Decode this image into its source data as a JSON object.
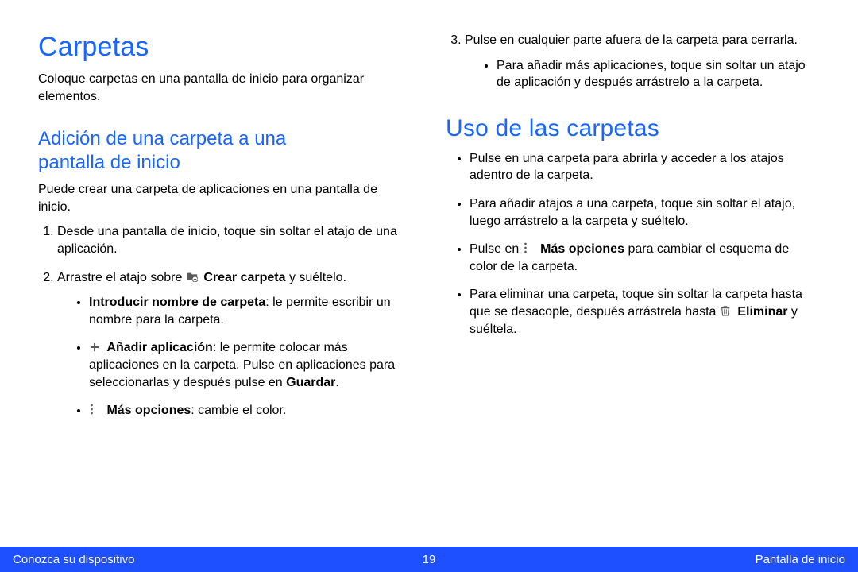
{
  "left": {
    "h1": "Carpetas",
    "intro": "Coloque carpetas en una pantalla de inicio para organizar elementos.",
    "sec1": {
      "h2_line1": "Adición de una carpeta a una",
      "h2_line2": "pantalla de inicio",
      "lead": "Puede crear una carpeta de aplicaciones en una pantalla de inicio.",
      "step1": "Desde una pantalla de inicio, toque sin soltar el atajo de una aplicación.",
      "step2_a": "Arrastre el atajo sobre ",
      "step2_bold": "Crear carpeta",
      "step2_b": " y suéltelo.",
      "sub1_bold": "Introducir nombre de carpeta",
      "sub1_rest": ": le permite escribir un nombre para la carpeta.",
      "sub2_bold": "Añadir aplicación",
      "sub2_rest_a": ": le permite colocar más aplicaciones en la carpeta. Pulse en aplicaciones para seleccionarlas y después pulse en ",
      "sub2_bold2": "Guardar",
      "sub2_rest_b": ".",
      "sub3_bold": "Más opciones",
      "sub3_rest": ": cambie el color."
    }
  },
  "right": {
    "step3": "Pulse en cualquier parte afuera de la carpeta para cerrarla.",
    "step3_sub": "Para añadir más aplicaciones, toque sin soltar un atajo de aplicación y después arrástrelo a la carpeta.",
    "h2": "Uso de las carpetas",
    "u1": "Pulse en una carpeta para abrirla y acceder a los atajos adentro de la carpeta.",
    "u2": "Para añadir atajos a una carpeta, toque sin soltar el atajo, luego arrástrelo a la carpeta y suéltelo.",
    "u3_a": "Pulse en ",
    "u3_bold": "Más opciones",
    "u3_b": " para cambiar el esquema de color de la carpeta.",
    "u4_a": "Para eliminar una carpeta, toque sin soltar la carpeta hasta que se desacople, después arrástrela hasta ",
    "u4_bold": "Eliminar",
    "u4_b": " y suéltela."
  },
  "footer": {
    "left": "Conozca su dispositivo",
    "page": "19",
    "right": "Pantalla de inicio"
  }
}
